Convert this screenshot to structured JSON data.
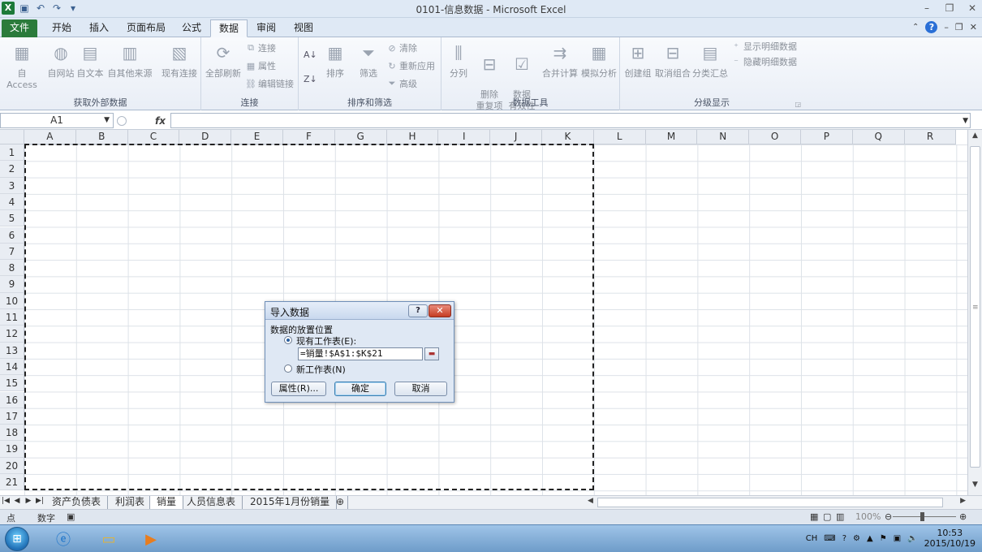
{
  "window": {
    "title": "0101-信息数据 - Microsoft Excel"
  },
  "tabs": [
    {
      "label": "文件"
    },
    {
      "label": "开始"
    },
    {
      "label": "插入"
    },
    {
      "label": "页面布局"
    },
    {
      "label": "公式"
    },
    {
      "label": "数据"
    },
    {
      "label": "审阅"
    },
    {
      "label": "视图"
    }
  ],
  "ribbon": {
    "external": {
      "label": "获取外部数据",
      "access": "自 Access",
      "web": "自网站",
      "text": "自文本",
      "other": "自其他来源",
      "existing": "现有连接"
    },
    "connections": {
      "label": "连接",
      "refresh_all": "全部刷新",
      "connections": "连接",
      "properties": "属性",
      "edit_links": "编辑链接"
    },
    "sort": {
      "label": "排序和筛选",
      "sort": "排序",
      "filter": "筛选",
      "clear": "清除",
      "reapply": "重新应用",
      "advanced": "高级"
    },
    "tools": {
      "label": "数据工具",
      "split": "分列",
      "remove_dup": "删除\n重复项",
      "validation": "数据\n有效性",
      "consolidate": "合并计算",
      "whatif": "模拟分析"
    },
    "outline": {
      "label": "分级显示",
      "group": "创建组",
      "ungroup": "取消组合",
      "subtotal": "分类汇总",
      "show_detail": "显示明细数据",
      "hide_detail": "隐藏明细数据"
    }
  },
  "formula_bar": {
    "name_box": "A1",
    "fx": "fx"
  },
  "columns": [
    "A",
    "B",
    "C",
    "D",
    "E",
    "F",
    "G",
    "H",
    "I",
    "J",
    "K",
    "L",
    "M",
    "N",
    "O",
    "P",
    "Q",
    "R"
  ],
  "rows": [
    "1",
    "2",
    "3",
    "4",
    "5",
    "6",
    "7",
    "8",
    "9",
    "10",
    "11",
    "12",
    "13",
    "14",
    "15",
    "16",
    "17",
    "18",
    "19",
    "20",
    "21"
  ],
  "sheets": [
    {
      "label": "资产负债表"
    },
    {
      "label": "利润表"
    },
    {
      "label": "销量"
    },
    {
      "label": "人员信息表"
    },
    {
      "label": "2015年1月份销量"
    }
  ],
  "status": {
    "mode": "点",
    "num": "数字",
    "zoom": "100%"
  },
  "dialog": {
    "title": "导入数据",
    "help": "?",
    "section": "数据的放置位置",
    "existing_label": "现有工作表(E):",
    "range_value": "=销量!$A$1:$K$21",
    "new_label": "新工作表(N)",
    "properties": "属性(R)...",
    "ok": "确定",
    "cancel": "取消"
  },
  "taskbar": {
    "lang": "CH",
    "time": "10:53",
    "date": "2015/10/19"
  }
}
